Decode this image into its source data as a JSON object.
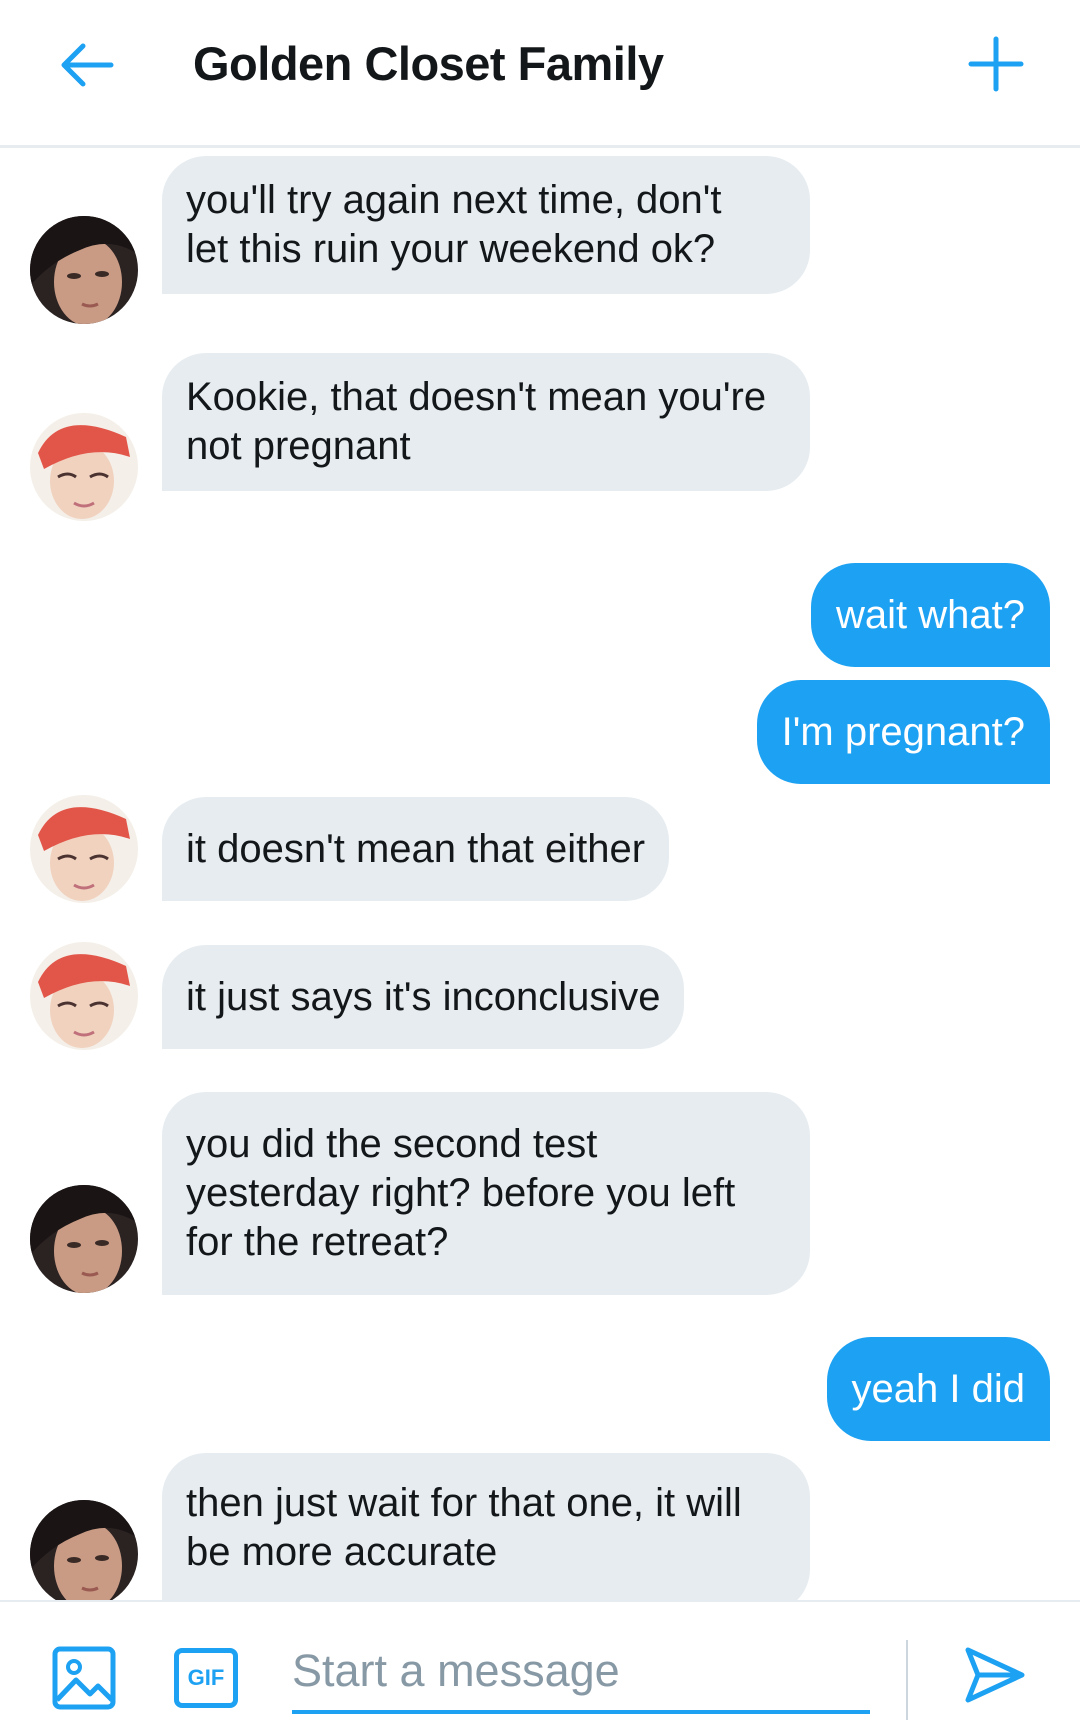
{
  "header": {
    "title": "Golden Closet Family",
    "back_icon": "arrow-left-icon",
    "add_icon": "plus-icon"
  },
  "colors": {
    "accent": "#1da1f2",
    "incoming_bubble": "#e6ecf0",
    "text": "#14171a",
    "placeholder": "#8899a6"
  },
  "messages": [
    {
      "sender": "them",
      "avatar": "avatar-jin",
      "text": [
        "you'll try again next time, don't",
        "let this ruin your weekend ok?"
      ]
    },
    {
      "sender": "them",
      "avatar": "avatar-red-hair",
      "text": [
        "Kookie, that doesn't mean you're",
        "not pregnant"
      ]
    },
    {
      "sender": "me",
      "text": [
        "wait what?"
      ]
    },
    {
      "sender": "me",
      "text": [
        "I'm pregnant?"
      ]
    },
    {
      "sender": "them",
      "avatar": "avatar-red-hair",
      "text": [
        "it doesn't mean that either"
      ]
    },
    {
      "sender": "them",
      "avatar": "avatar-red-hair",
      "text": [
        "it just says it's inconclusive"
      ]
    },
    {
      "sender": "them",
      "avatar": "avatar-jin",
      "text": [
        "you did the second test",
        "yesterday right? before you left",
        "for the retreat?"
      ]
    },
    {
      "sender": "me",
      "text": [
        "yeah I did"
      ]
    },
    {
      "sender": "them",
      "avatar": "avatar-jin",
      "text": [
        "then just wait for that one, it will",
        "be more accurate"
      ]
    }
  ],
  "composer": {
    "media_icon": "image-icon",
    "gif_label": "GIF",
    "placeholder": "Start a message",
    "value": "",
    "send_icon": "send-icon"
  }
}
